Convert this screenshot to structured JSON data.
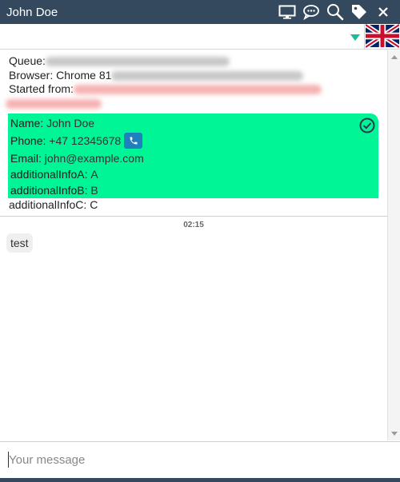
{
  "window": {
    "title": "John Doe",
    "icons": [
      "monitor-icon",
      "chat-bubble-icon",
      "search-icon",
      "tag-icon",
      "close-icon"
    ]
  },
  "language": {
    "flag": "uk-flag-icon",
    "accent": "#1abc9c"
  },
  "meta": {
    "queue_label": "Queue",
    "browser_label": "Browser",
    "browser_value": "Chrome 81",
    "started_label": "Started from"
  },
  "contact": {
    "name_key": "Name",
    "name_val": "John Doe",
    "phone_key": "Phone",
    "phone_val": "+47 12345678",
    "email_key": "Email",
    "email_val": "john@example.com",
    "a_key": "additionalInfoA",
    "a_val": "A",
    "b_key": "additionalInfoB",
    "b_val": "B",
    "c_key": "additionalInfoC",
    "c_val": "C",
    "card_color": "#00f596"
  },
  "chat": {
    "timestamp": "02:15",
    "messages": [
      {
        "text": "test"
      }
    ]
  },
  "composer": {
    "placeholder": "Your message",
    "value": ""
  },
  "colors": {
    "titlebar": "#34495e",
    "phone_button": "#1f7fbf"
  }
}
